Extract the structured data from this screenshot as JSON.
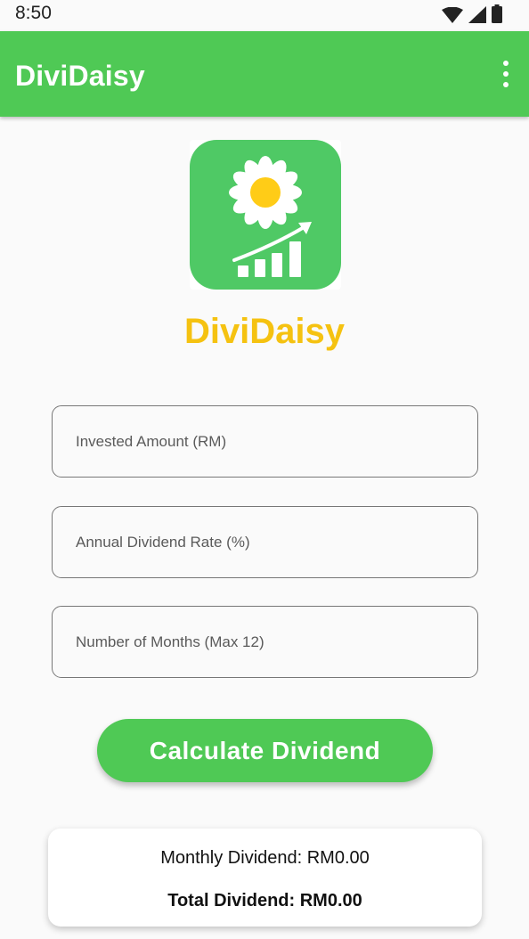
{
  "status_bar": {
    "time": "8:50",
    "icons": [
      "wifi-icon",
      "cell-signal-icon",
      "battery-icon"
    ]
  },
  "app_bar": {
    "title": "DiviDaisy",
    "menu_icon": "more-vert-icon"
  },
  "logo": {
    "icon": "daisy-growth-logo",
    "background_color": "#4fc965",
    "petal_color": "#ffffff",
    "center_color": "#ffcc17"
  },
  "brand_name": "DiviDaisy",
  "form": {
    "invested_amount": {
      "placeholder": "Invested Amount (RM)",
      "value": ""
    },
    "dividend_rate": {
      "placeholder": "Annual Dividend Rate (%)",
      "value": ""
    },
    "months": {
      "placeholder": "Number of Months (Max 12)",
      "value": ""
    }
  },
  "calculate_button_label": "Calculate Dividend",
  "results": {
    "monthly_dividend": "Monthly Dividend: RM0.00",
    "total_dividend": "Total Dividend: RM0.00"
  },
  "colors": {
    "primary": "#4fc955",
    "brand_text": "#f5c211",
    "background": "#fafafa"
  }
}
